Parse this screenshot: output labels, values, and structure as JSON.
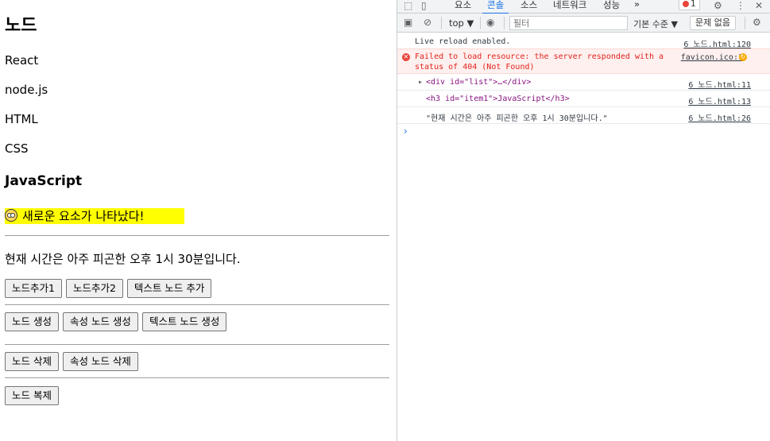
{
  "page": {
    "heading": "노드",
    "items": [
      "React",
      "node.js",
      "HTML",
      "CSS"
    ],
    "h3": "JavaScript",
    "highlight_text": "새로운 요소가 나타났다!",
    "time_text": "현재 시간은 아주 피곤한 오후 1시 30분입니다.",
    "buttons_row1": [
      "노드추가1",
      "노드추가2",
      "텍스트 노드 추가"
    ],
    "buttons_row2": [
      "노드 생성",
      "속성 노드 생성",
      "텍스트 노드 생성"
    ],
    "buttons_row3": [
      "노드 삭제",
      "속성 노드 삭제"
    ],
    "buttons_row4": [
      "노드 복제"
    ]
  },
  "devtools": {
    "tabs": [
      "요소",
      "콘솔",
      "소스",
      "네트워크",
      "성능"
    ],
    "active_tab": "콘솔",
    "more": "»",
    "error_count": "1",
    "context": "top ▼",
    "filter_placeholder": "필터",
    "levels": "기본 수준 ▼",
    "issues": "문제 없음",
    "logs": [
      {
        "text": "Live reload enabled.",
        "source": "6 노드.html:120"
      },
      {
        "text": "Failed to load resource: the server responded with a\nstatus of 404 (Not Found)",
        "source": "favicon.ico:1"
      },
      {
        "text": "<div id=\"list\">…</div>",
        "source": "6 노드.html:11"
      },
      {
        "text": "<h3 id=\"item1\">JavaScript</h3>",
        "source": "6 노드.html:13"
      },
      {
        "text": "\"현재 시간은 아주 피곤한 오후 1시 30분입니다.\"",
        "source": "6 노드.html:26"
      }
    ],
    "prompt": "›"
  },
  "colors": {
    "highlight": "#ffff00",
    "accent": "#1a73e8",
    "error": "#e0241b"
  },
  "icons": [
    "inspect-icon",
    "device-toggle-icon",
    "sidebar-icon",
    "clear-icon",
    "eye-icon",
    "settings-icon",
    "kebab-menu-icon",
    "close-icon",
    "error-icon",
    "warning-icon",
    "expand-arrow-icon",
    "emoji-face-icon"
  ]
}
